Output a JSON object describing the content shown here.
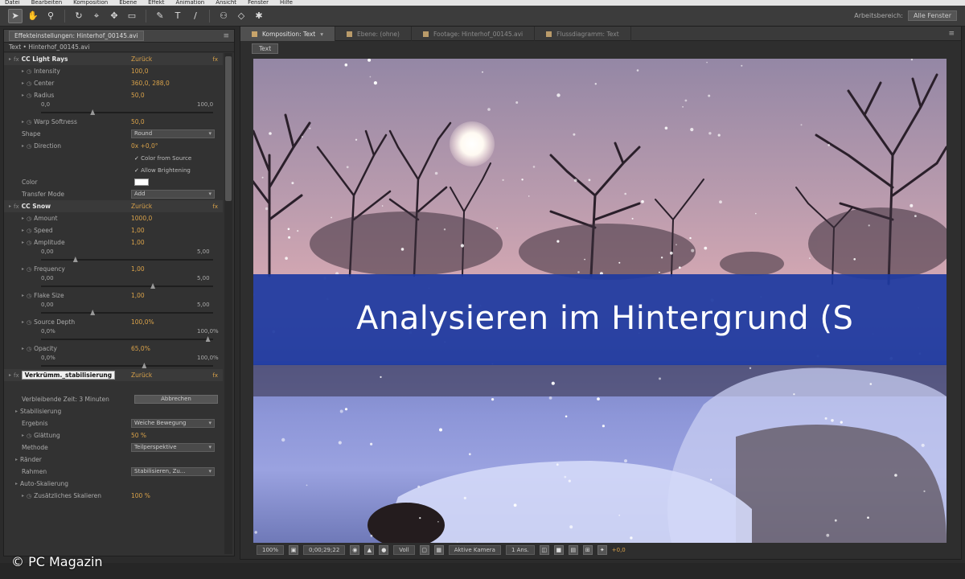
{
  "menubar": [
    "Datei",
    "Bearbeiten",
    "Komposition",
    "Ebene",
    "Effekt",
    "Animation",
    "Ansicht",
    "Fenster",
    "Hilfe"
  ],
  "toolbar": {
    "tools": [
      {
        "icon": "selection-arrow-icon",
        "glyph": "➤",
        "active": true
      },
      {
        "icon": "hand-icon",
        "glyph": "✋",
        "active": false
      },
      {
        "icon": "zoom-icon",
        "glyph": "⚲",
        "active": false
      },
      {
        "icon": "rotate-icon",
        "glyph": "↻",
        "active": false
      },
      {
        "icon": "camera-icon",
        "glyph": "⌖",
        "active": false
      },
      {
        "icon": "pan-behind-icon",
        "glyph": "✥",
        "active": false
      },
      {
        "icon": "rectangle-icon",
        "glyph": "▭",
        "active": false
      },
      {
        "icon": "pen-icon",
        "glyph": "✎",
        "active": false
      },
      {
        "icon": "text-icon",
        "glyph": "T",
        "active": false
      },
      {
        "icon": "brush-icon",
        "glyph": "/",
        "active": false
      },
      {
        "icon": "clone-stamp-icon",
        "glyph": "⚇",
        "active": false
      },
      {
        "icon": "eraser-icon",
        "glyph": "◇",
        "active": false
      },
      {
        "icon": "puppet-icon",
        "glyph": "✱",
        "active": false
      }
    ],
    "workspace_label": "Arbeitsbereich:",
    "workspace_value": "Alle Fenster"
  },
  "effects_panel": {
    "tab_label": "Effekteinstellungen: Hinterhof_00145.avi",
    "subtitle": "Text • Hinterhof_00145.avi",
    "rows": [
      {
        "kind": "effect",
        "name": "CC Light Rays",
        "value": "Zurück",
        "fx": "fx"
      },
      {
        "kind": "param",
        "name": "Intensity",
        "value": "100,0"
      },
      {
        "kind": "param",
        "name": "Center",
        "value": "360,0, 288,0"
      },
      {
        "kind": "param",
        "name": "Radius",
        "value": "50,0"
      },
      {
        "kind": "slider",
        "lo": "0,0",
        "hi": "100,0",
        "pos": 0.3
      },
      {
        "kind": "param",
        "name": "Warp Softness",
        "value": "50,0"
      },
      {
        "kind": "dropdown",
        "name": "Shape",
        "value": "Round"
      },
      {
        "kind": "param",
        "name": "Direction",
        "value": "0x +0,0°"
      },
      {
        "kind": "check",
        "name": "",
        "value": "Color from Source"
      },
      {
        "kind": "check",
        "name": "",
        "value": "Allow Brightening"
      },
      {
        "kind": "swatch",
        "name": "Color"
      },
      {
        "kind": "dropdown",
        "name": "Transfer Mode",
        "value": "Add"
      },
      {
        "kind": "effect",
        "name": "CC Snow",
        "value": "Zurück",
        "fx": "fx"
      },
      {
        "kind": "param",
        "name": "Amount",
        "value": "1000,0"
      },
      {
        "kind": "param",
        "name": "Speed",
        "value": "1,00"
      },
      {
        "kind": "param",
        "name": "Amplitude",
        "value": "1,00"
      },
      {
        "kind": "slider",
        "lo": "0,00",
        "hi": "5,00",
        "pos": 0.2
      },
      {
        "kind": "param",
        "name": "Frequency",
        "value": "1,00"
      },
      {
        "kind": "slider",
        "lo": "0,00",
        "hi": "5,00",
        "pos": 0.65
      },
      {
        "kind": "param",
        "name": "Flake Size",
        "value": "1,00"
      },
      {
        "kind": "slider",
        "lo": "0,00",
        "hi": "5,00",
        "pos": 0.3
      },
      {
        "kind": "param",
        "name": "Source Depth",
        "value": "100,0%"
      },
      {
        "kind": "slider",
        "lo": "0,0%",
        "hi": "100,0%",
        "pos": 0.97
      },
      {
        "kind": "param",
        "name": "Opacity",
        "value": "65,0%"
      },
      {
        "kind": "slider",
        "lo": "0,0%",
        "hi": "100,0%",
        "pos": 0.6
      },
      {
        "kind": "highlight",
        "name": "Verkrümm._stabilisierung",
        "value": "Zurück",
        "fx": "fx"
      },
      {
        "kind": "blank"
      },
      {
        "kind": "button",
        "name": "Verbleibende Zeit: 3 Minuten",
        "value": "Abbrechen"
      },
      {
        "kind": "group",
        "name": "Stabilisierung"
      },
      {
        "kind": "dropdown",
        "name": "Ergebnis",
        "value": "Weiche Bewegung"
      },
      {
        "kind": "param",
        "name": "Glättung",
        "value": "50 %"
      },
      {
        "kind": "dropdown",
        "name": "Methode",
        "value": "Teilperspektive"
      },
      {
        "kind": "group",
        "name": "Ränder"
      },
      {
        "kind": "dropdown",
        "name": "Rahmen",
        "value": "Stabilisieren, Zu..."
      },
      {
        "kind": "group",
        "name": "Auto-Skalierung"
      },
      {
        "kind": "param",
        "name": "Zusätzliches Skalieren",
        "value": "100 %"
      }
    ]
  },
  "composition": {
    "tabs": [
      {
        "label": "Komposition: Text",
        "active": true
      },
      {
        "label": "Ebene: (ohne)",
        "active": false
      },
      {
        "label": "Footage: Hinterhof_00145.avi",
        "active": false
      },
      {
        "label": "Flussdiagramm: Text",
        "active": false
      }
    ],
    "sub_tab": "Text",
    "banner_text": "Analysieren im Hintergrund (S",
    "footer": {
      "zoom": "100%",
      "timecode": "0;00;29;22",
      "quality": "Voll",
      "camera": "Aktive Kamera",
      "views": "1 Ans.",
      "offset": "+0,0"
    }
  },
  "watermark": "© PC Magazin"
}
